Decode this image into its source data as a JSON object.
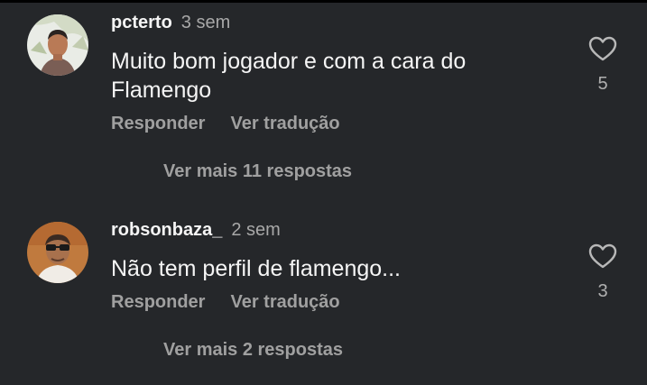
{
  "comments": [
    {
      "username": "pcterto",
      "time": "3 sem",
      "text": "Muito bom jogador e com a cara do Flamengo",
      "reply_label": "Responder",
      "translate_label": "Ver tradução",
      "likes": "5",
      "more_replies": "Ver mais 11 respostas",
      "avatar_icon": "user-avatar"
    },
    {
      "username": "robsonbaza_",
      "time": "2 sem",
      "text": "Não tem perfil de flamengo...",
      "reply_label": "Responder",
      "translate_label": "Ver tradução",
      "likes": "3",
      "more_replies": "Ver mais 2 respostas",
      "avatar_icon": "user-avatar"
    }
  ],
  "icons": {
    "like": "heart-outline-icon"
  },
  "colors": {
    "background": "#25272a",
    "text_primary": "#f5f5f5",
    "text_secondary": "#a0a0a0"
  }
}
